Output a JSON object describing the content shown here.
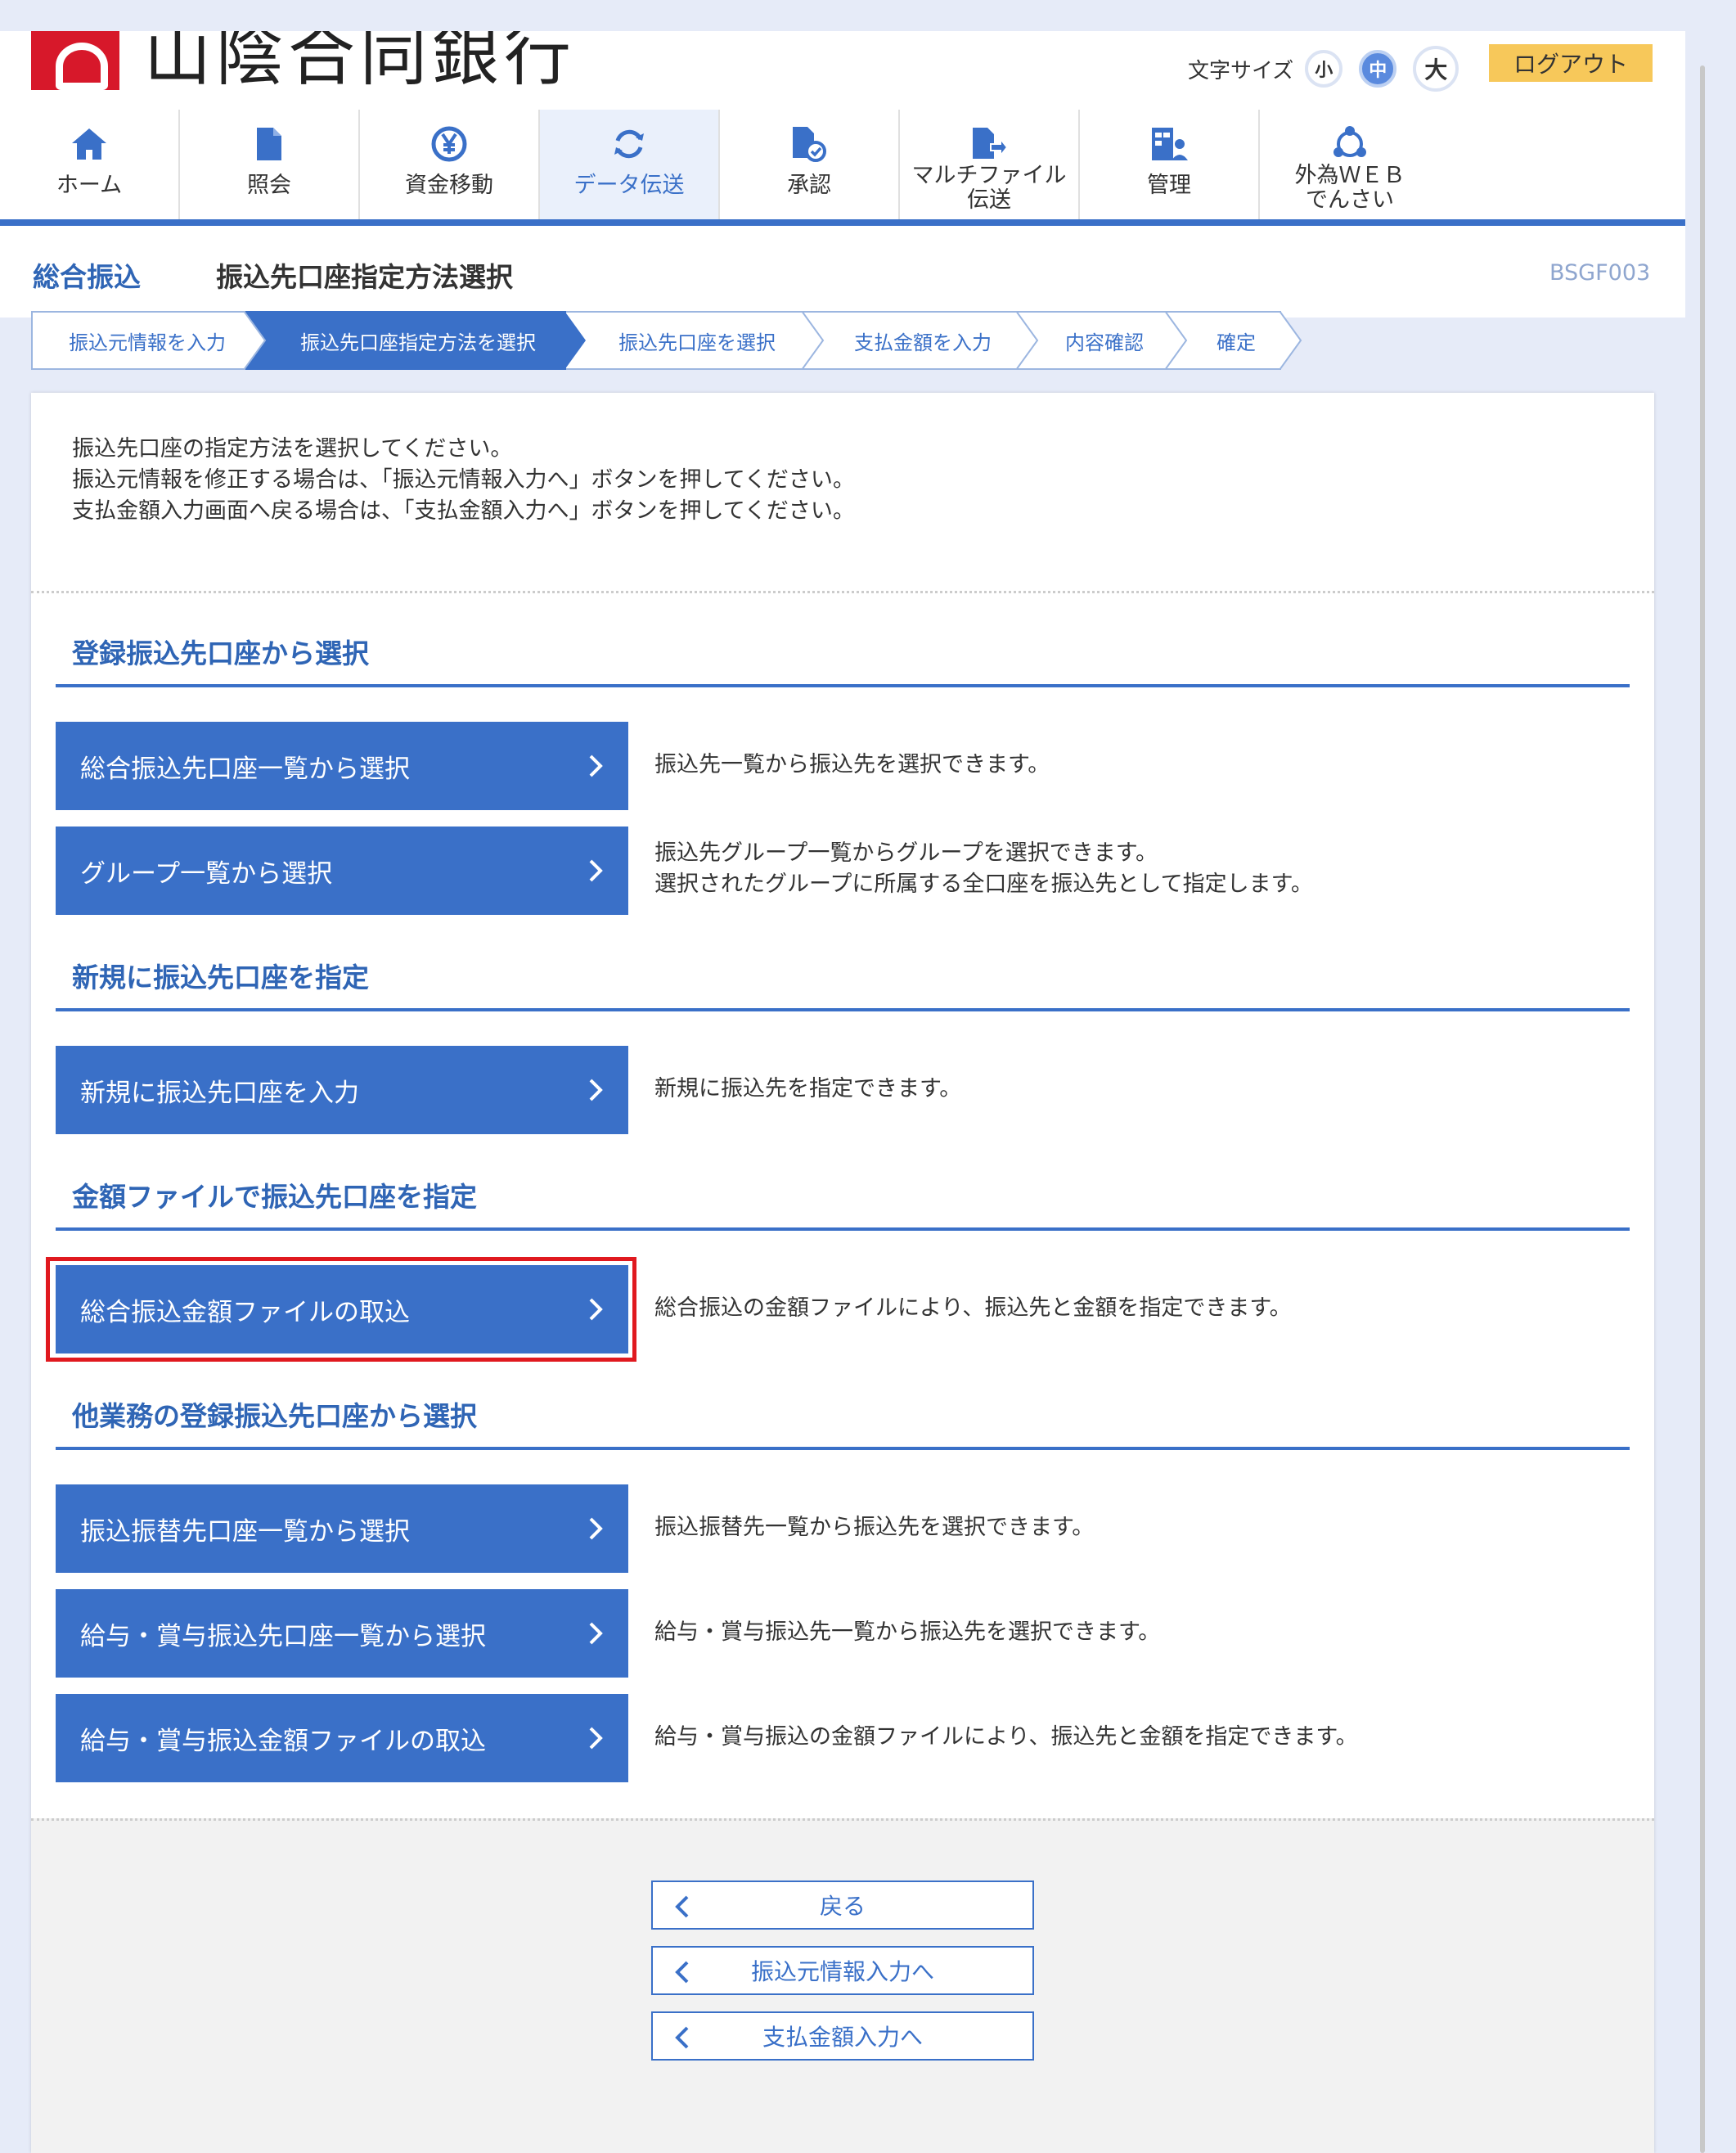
{
  "header": {
    "bank_name": "山陰合同銀行",
    "font_size_label": "文字サイズ",
    "font_small": "小",
    "font_medium": "中",
    "font_large": "大",
    "logout": "ログアウト"
  },
  "nav": {
    "items": [
      {
        "label": "ホーム",
        "icon": "home-icon"
      },
      {
        "label": "照会",
        "icon": "document-icon"
      },
      {
        "label": "資金移動",
        "icon": "yen-transfer-icon"
      },
      {
        "label": "データ伝送",
        "icon": "sync-icon",
        "active": true
      },
      {
        "label": "承認",
        "icon": "approve-document-icon"
      },
      {
        "label": "マルチファイル\n伝送",
        "icon": "file-upload-icon"
      },
      {
        "label": "管理",
        "icon": "admin-icon"
      },
      {
        "label": "外為ＷＥＢ\nでんさい",
        "icon": "network-icon"
      }
    ]
  },
  "title": {
    "category": "総合振込",
    "main": "振込先口座指定方法選択",
    "screen_id": "BSGF003"
  },
  "steps": [
    "振込元情報を入力",
    "振込先口座指定方法を選択",
    "振込先口座を選択",
    "支払金額を入力",
    "内容確認",
    "確定"
  ],
  "intro": {
    "line1": "振込先口座の指定方法を選択してください。",
    "line2": "振込元情報を修正する場合は、「振込元情報入力へ」ボタンを押してください。",
    "line3": "支払金額入力画面へ戻る場合は、「支払金額入力へ」ボタンを押してください。"
  },
  "sections": {
    "registered": {
      "title": "登録振込先口座から選択",
      "btn1": "総合振込先口座一覧から選択",
      "desc1": "振込先一覧から振込先を選択できます。",
      "btn2": "グループ一覧から選択",
      "desc2a": "振込先グループ一覧からグループを選択できます。",
      "desc2b": "選択されたグループに所属する全口座を振込先として指定します。"
    },
    "new": {
      "title": "新規に振込先口座を指定",
      "btn1": "新規に振込先口座を入力",
      "desc1": "新規に振込先を指定できます。"
    },
    "file": {
      "title": "金額ファイルで振込先口座を指定",
      "btn1": "総合振込金額ファイルの取込",
      "desc1": "総合振込の金額ファイルにより、振込先と金額を指定できます。"
    },
    "other": {
      "title": "他業務の登録振込先口座から選択",
      "btn1": "振込振替先口座一覧から選択",
      "desc1": "振込振替先一覧から振込先を選択できます。",
      "btn2": "給与・賞与振込先口座一覧から選択",
      "desc2": "給与・賞与振込先一覧から振込先を選択できます。",
      "btn3": "給与・賞与振込金額ファイルの取込",
      "desc3": "給与・賞与振込の金額ファイルにより、振込先と金額を指定できます。"
    }
  },
  "footer": {
    "back": "戻る",
    "to_source": "振込元情報入力へ",
    "to_amount": "支払金額入力へ"
  },
  "colors": {
    "primary": "#3a70c8",
    "heading": "#2f65b5",
    "logout": "#f7c85a",
    "highlight": "#e0191f",
    "brand_red": "#d7182a"
  }
}
